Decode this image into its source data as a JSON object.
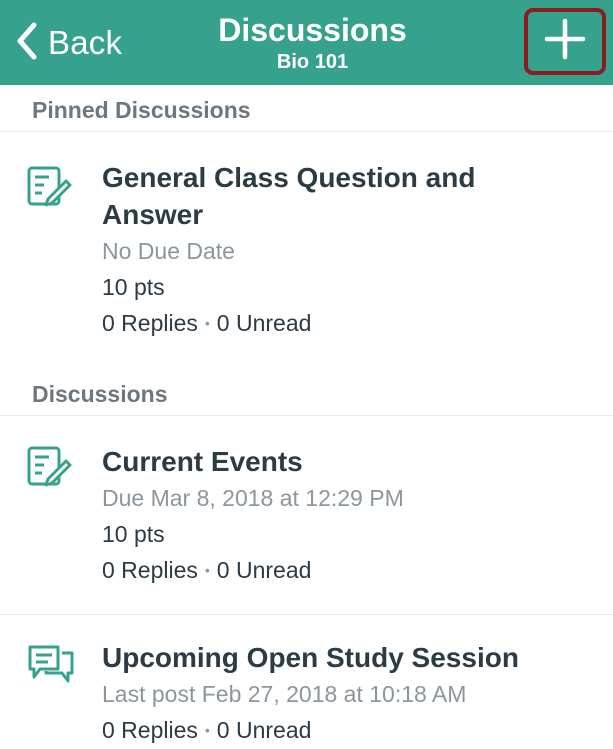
{
  "nav": {
    "back_label": "Back",
    "title": "Discussions",
    "subtitle": "Bio 101",
    "add_icon": "plus-icon"
  },
  "colors": {
    "header_bg": "#36a28e",
    "accent": "#36a28e",
    "highlight_border": "#8a1d24",
    "text_primary": "#2d3b45",
    "text_secondary": "#8b969e"
  },
  "sections": [
    {
      "header": "Pinned Discussions",
      "items": [
        {
          "icon": "discussion-edit-icon",
          "title_line1": "General Class Question and",
          "title_line2": "Answer",
          "meta": "No Due Date",
          "points": "10 pts",
          "replies": "0 Replies",
          "unread": "0 Unread"
        }
      ]
    },
    {
      "header": "Discussions",
      "items": [
        {
          "icon": "discussion-edit-icon",
          "title": "Current Events",
          "meta": "Due Mar 8, 2018 at 12:29 PM",
          "points": "10 pts",
          "replies": "0 Replies",
          "unread": "0 Unread"
        },
        {
          "icon": "chat-bubbles-icon",
          "title": "Upcoming Open Study Session",
          "meta": "Last post Feb 27, 2018 at 10:18 AM",
          "replies": "0 Replies",
          "unread": "0 Unread"
        }
      ]
    }
  ]
}
